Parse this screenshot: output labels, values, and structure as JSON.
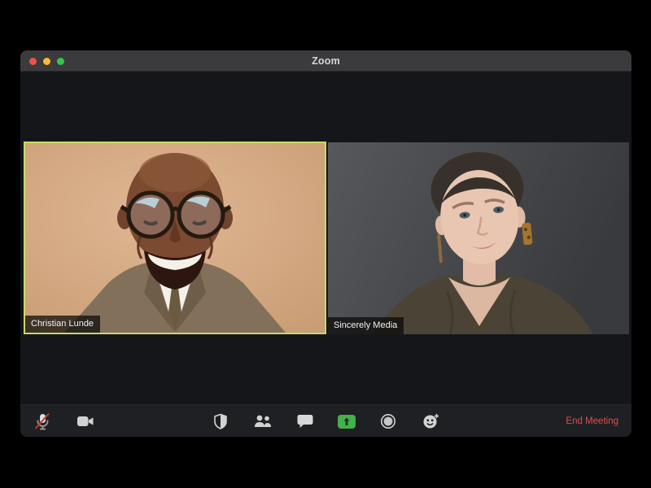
{
  "window": {
    "title": "Zoom",
    "controls": [
      "close",
      "minimize",
      "fullscreen"
    ]
  },
  "participants": [
    {
      "name": "Christian Lunde",
      "active_speaker": true
    },
    {
      "name": "Sincerely Media",
      "active_speaker": false
    }
  ],
  "toolbar": {
    "buttons": [
      {
        "id": "mute",
        "icon": "muted-mic-icon",
        "state": "muted"
      },
      {
        "id": "video",
        "icon": "video-camera-icon",
        "state": "on"
      },
      {
        "id": "security",
        "icon": "security-shield-icon"
      },
      {
        "id": "participants",
        "icon": "participants-icon"
      },
      {
        "id": "chat",
        "icon": "chat-bubble-icon"
      },
      {
        "id": "share-screen",
        "icon": "share-screen-icon"
      },
      {
        "id": "record",
        "icon": "record-icon"
      },
      {
        "id": "reactions",
        "icon": "reactions-icon"
      }
    ],
    "end_meeting_label": "End Meeting"
  },
  "colors": {
    "active_speaker_border": "#c9da5e",
    "share_screen_green": "#44b14a",
    "end_meeting_red": "#e04f4f",
    "muted_slash_red": "#c23a30"
  }
}
